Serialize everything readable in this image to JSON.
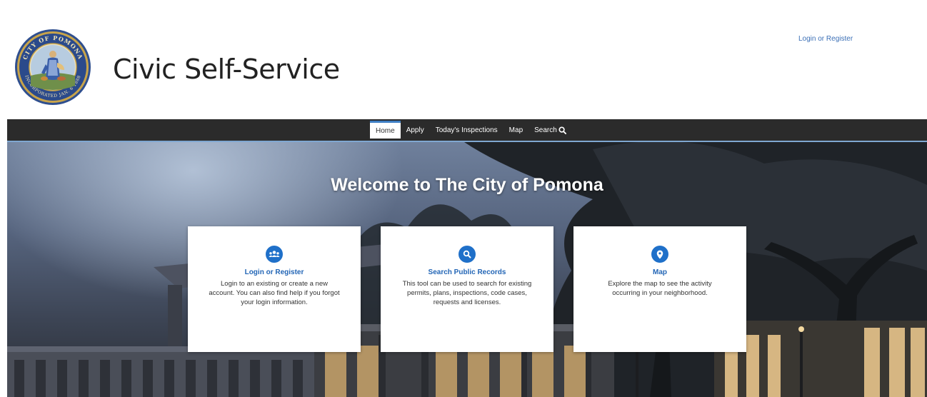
{
  "header": {
    "site_title": "Civic Self-Service",
    "login_link": "Login or Register",
    "seal": {
      "top_text": "CITY OF POMONA",
      "bottom_text": "INCORPORATED JAN. 6 1888"
    }
  },
  "nav": {
    "items": [
      {
        "label": "Home",
        "active": true
      },
      {
        "label": "Apply"
      },
      {
        "label": "Today's Inspections"
      },
      {
        "label": "Map"
      },
      {
        "label": "Search",
        "icon": "search-icon"
      }
    ]
  },
  "hero": {
    "title": "Welcome to The City of Pomona"
  },
  "cards": [
    {
      "icon": "users-icon",
      "title": "Login or Register",
      "text": "Login to an existing or create a new account. You can also find help if you forgot your login information."
    },
    {
      "icon": "search-icon",
      "title": "Search Public Records",
      "text": "This tool can be used to search for existing permits, plans, inspections, code cases, requests and licenses."
    },
    {
      "icon": "map-pin-icon",
      "title": "Map",
      "text": "Explore the map to see the activity occurring in your neighborhood."
    }
  ],
  "colors": {
    "accent_blue": "#1f70c9",
    "link_blue": "#2366b6",
    "nav_bg": "#2b2b2b",
    "nav_underline": "#7fa7d1"
  }
}
